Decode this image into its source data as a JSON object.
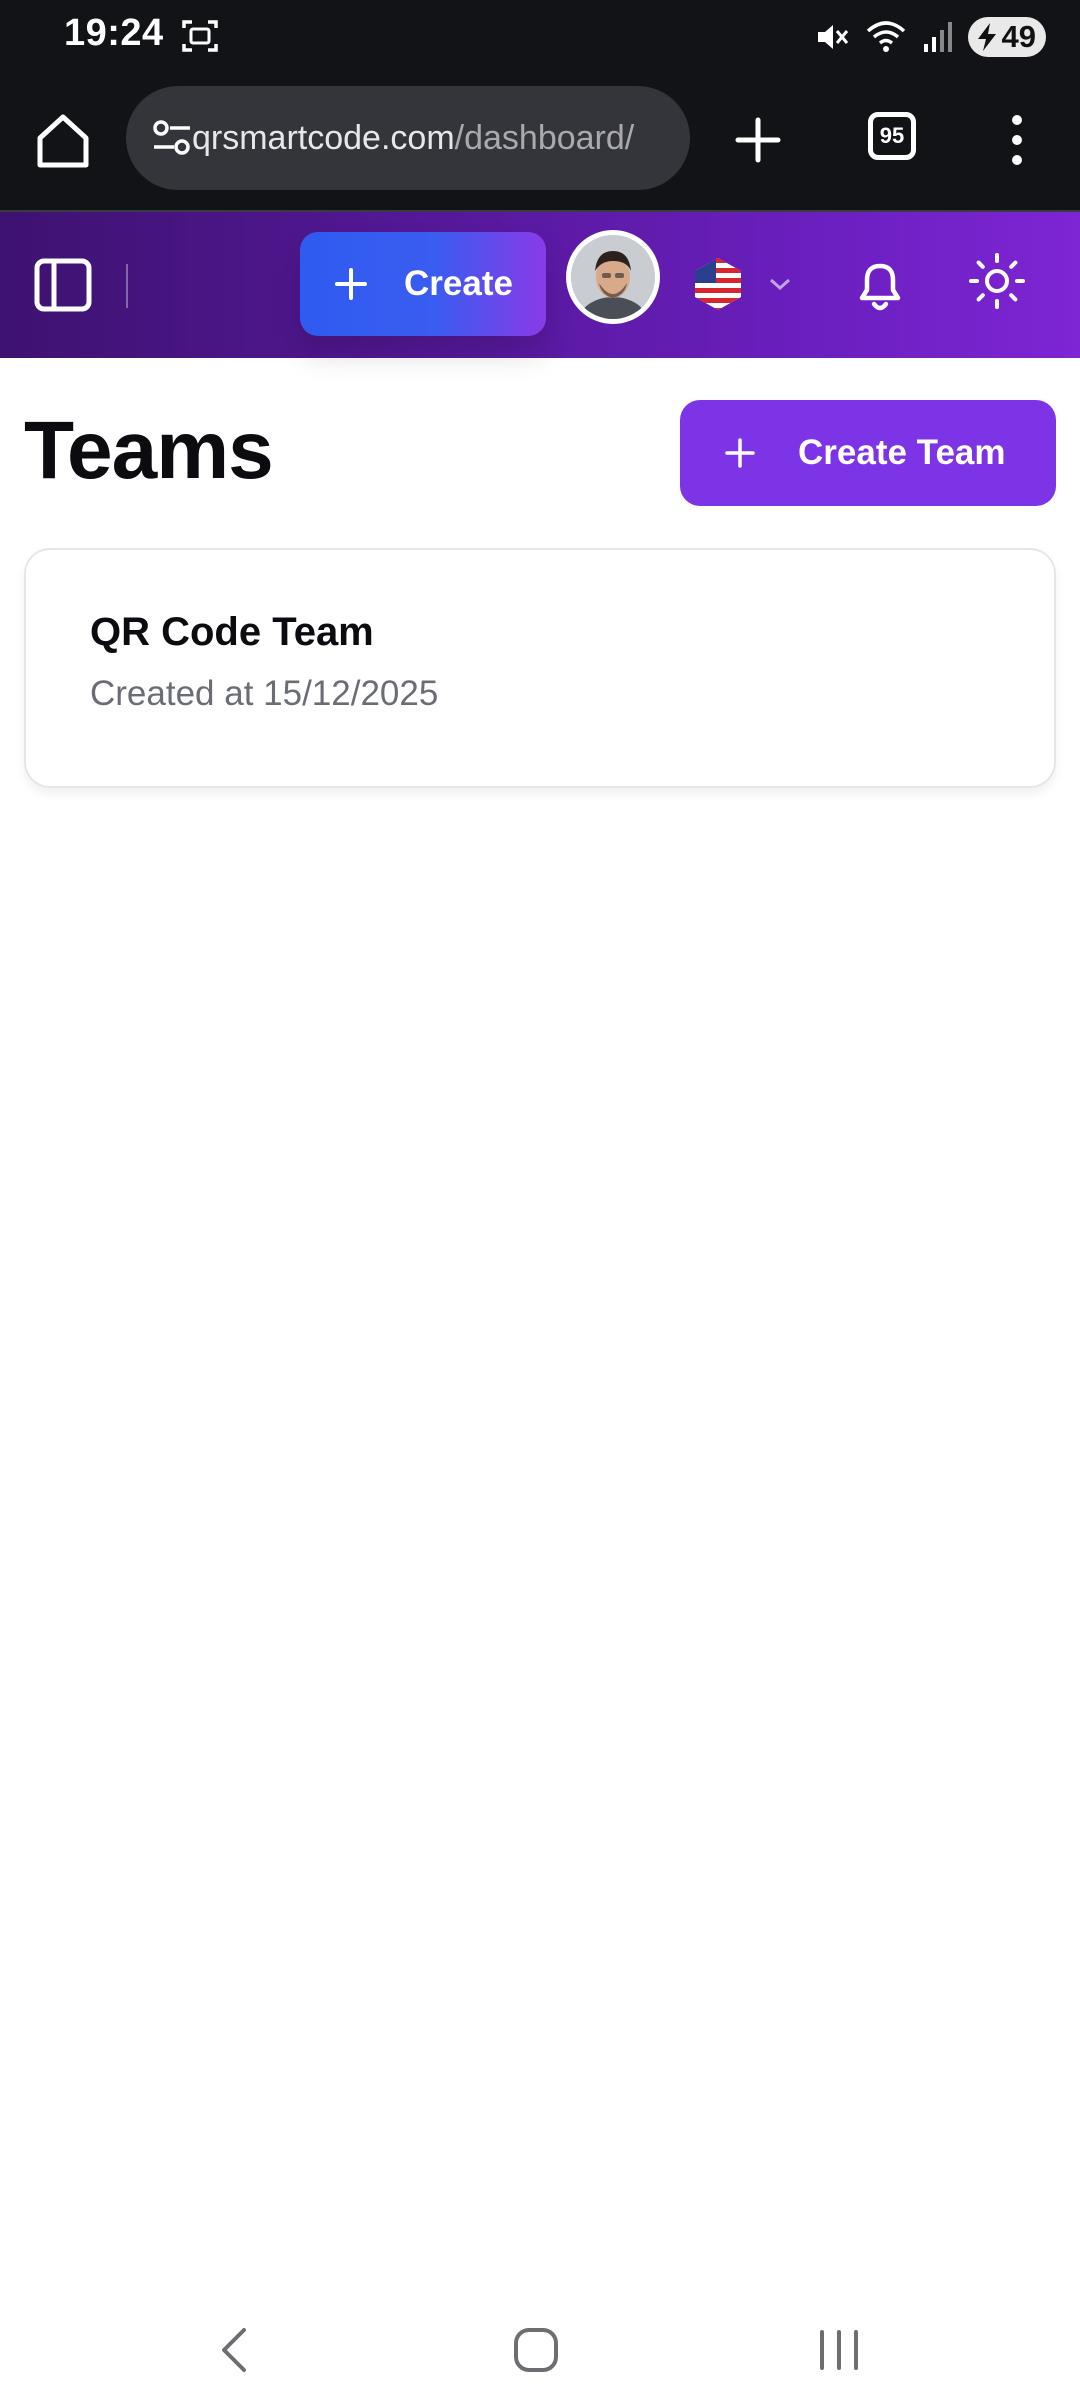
{
  "status_bar": {
    "time": "19:24",
    "battery": "49",
    "icons": [
      "screenshot-icon",
      "mute-icon",
      "wifi-icon",
      "signal-icon",
      "battery-icon"
    ]
  },
  "browser": {
    "url_main": "qrsmartcode.com",
    "url_path": "/dashboard/",
    "tab_count": "95"
  },
  "header": {
    "create_label": "Create",
    "language": "us",
    "colors": {
      "gradient_start": "#3d1270",
      "gradient_end": "#7e25d4",
      "create_start": "#2f5bf0",
      "create_end": "#8a3ae8"
    }
  },
  "page": {
    "title": "Teams",
    "create_team_label": "Create Team",
    "accent": "#7c34e6"
  },
  "teams": [
    {
      "name": "QR Code Team",
      "created": "Created at 15/12/2025"
    }
  ]
}
